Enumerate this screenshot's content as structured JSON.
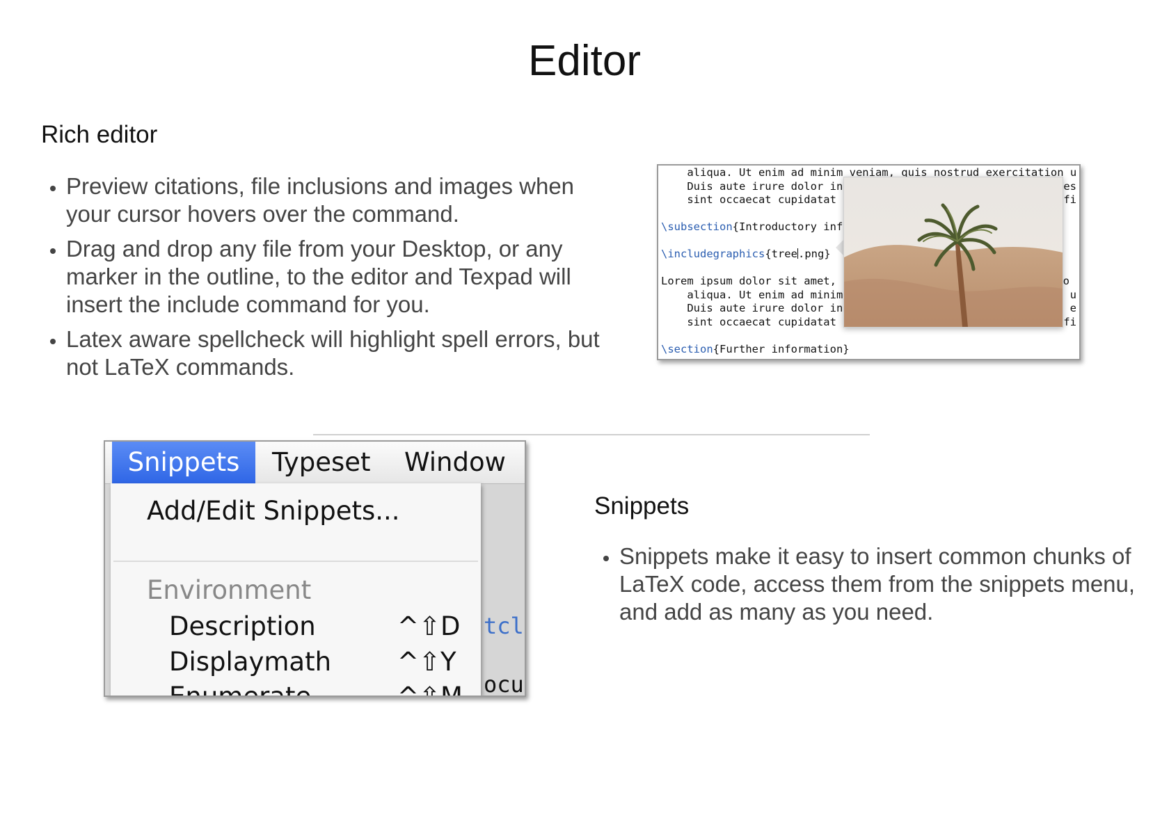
{
  "slide": {
    "title": "Editor"
  },
  "rich_editor": {
    "heading": "Rich editor",
    "bullets": [
      "Preview citations, file inclusions and images when your cursor hovers over the command.",
      "Drag and drop any file from your Desktop, or any marker in the outline, to the editor and Texpad will insert the include command for you.",
      "Latex aware spellcheck will highlight spell errors, but not LaTeX commands."
    ]
  },
  "editor_screenshot": {
    "line1": "    aliqua. Ut enim ad minim veniam, quis nostrud exercitation u",
    "line2": "    Duis aute irure dolor in",
    "line3": "    sint occaecat cupidatat",
    "subsection_cmd": "\\subsection",
    "subsection_arg": "{Introductory inf",
    "include_cmd": "\\includegraphics",
    "include_arg_a": "{tree",
    "include_arg_b": ".png}",
    "line6": "Lorem ipsum dolor sit amet,",
    "line7": "    aliqua. Ut enim ad minim",
    "line8": "    Duis aute irure dolor in",
    "line9": "    sint occaecat cupidatat",
    "section_cmd": "\\section",
    "section_arg": "{Further information}",
    "edge1": "es",
    "edge2": "ffi",
    "edge3": "lo",
    "edge4": "u",
    "edge5": "e",
    "edge6": "ffi",
    "preview_icon": "palm-tree-image-icon"
  },
  "snippets": {
    "heading": "Snippets",
    "bullets": [
      "Snippets make it easy to insert common chunks of LaTeX code, access them from the snippets menu, and add as many as you need."
    ]
  },
  "menu_screenshot": {
    "menubar": [
      "Snippets",
      "Typeset",
      "Window"
    ],
    "add_edit": "Add/Edit Snippets...",
    "section_header": "Environment",
    "items": [
      {
        "label": "Description",
        "shortcut": "^⇧D"
      },
      {
        "label": "Displaymath",
        "shortcut": "^⇧Y"
      },
      {
        "label": "Enumerate",
        "shortcut": "^⇧M"
      }
    ],
    "bg_code_1": "tcl",
    "bg_code_2": "ocu",
    "active_color": "#3b72ea"
  }
}
